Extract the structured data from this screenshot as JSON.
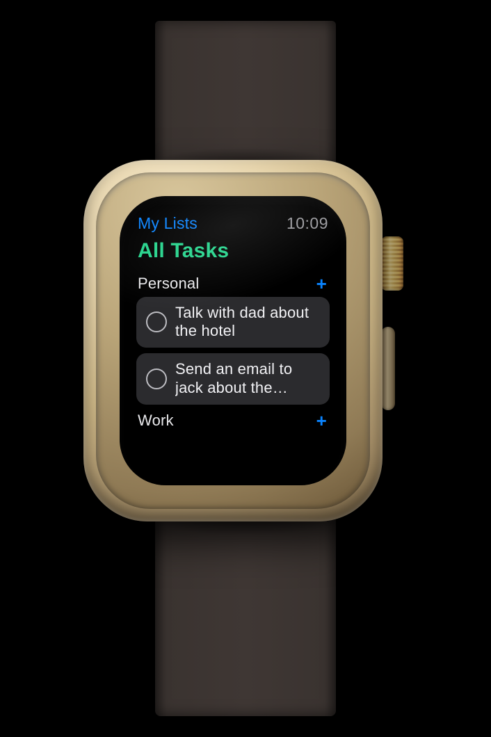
{
  "status": {
    "back_label": "My Lists",
    "time": "10:09"
  },
  "title": "All Tasks",
  "sections": [
    {
      "name": "Personal",
      "add_icon": "plus-icon",
      "tasks": [
        {
          "text": "Talk with dad about the hotel"
        },
        {
          "text": "Send an email to jack about the…"
        }
      ]
    },
    {
      "name": "Work",
      "add_icon": "plus-icon",
      "tasks": []
    }
  ],
  "colors": {
    "accent_blue": "#0a84ff",
    "accent_green": "#24d38b",
    "row_bg": "#2b2b2e"
  }
}
